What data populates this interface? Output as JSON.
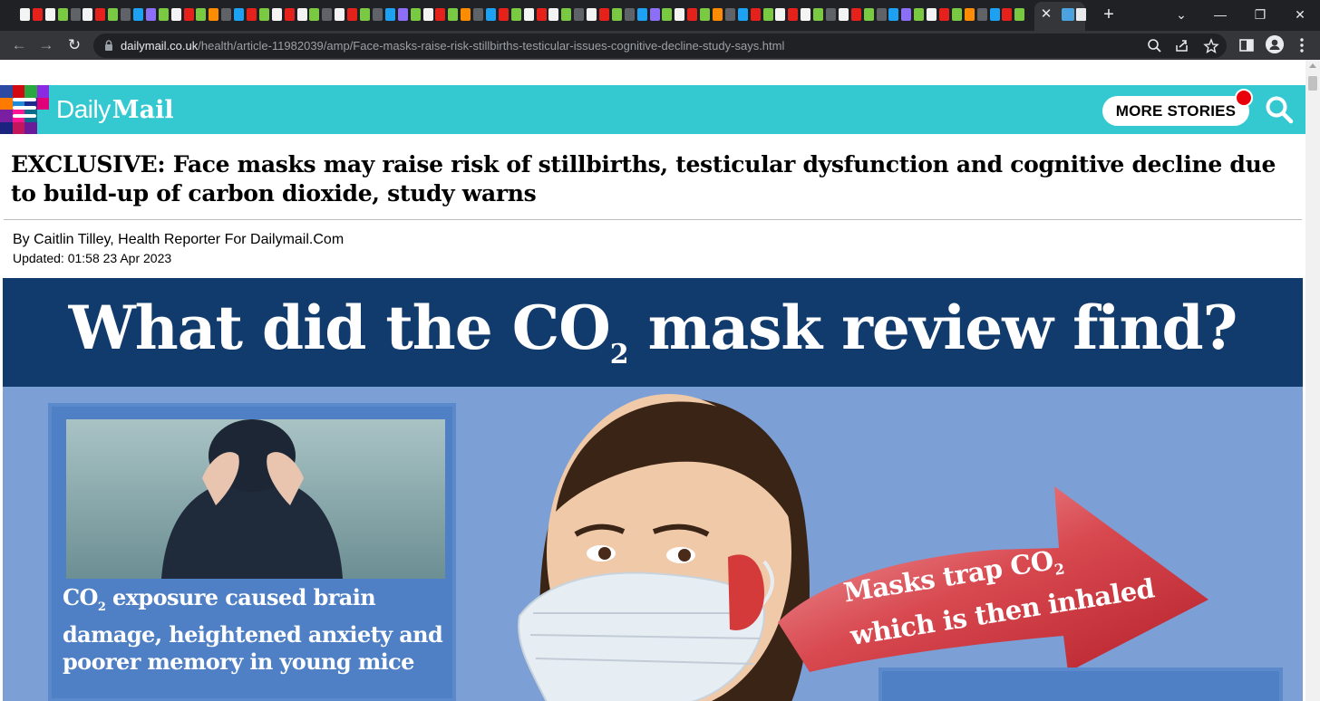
{
  "browser": {
    "url_domain": "dailymail.co.uk",
    "url_path": "/health/article-11982039/amp/Face-masks-raise-risk-stillbirths-testicular-issues-cognitive-decline-study-says.html",
    "tab_close_glyph": "✕",
    "new_tab_glyph": "+",
    "window_controls": {
      "tab_search": "⌄",
      "minimize": "—",
      "restore": "❐",
      "close": "✕"
    },
    "nav": {
      "back": "←",
      "forward": "→",
      "reload": "↻"
    },
    "toolbar_icons": [
      "zoom-icon",
      "share-icon",
      "bookmark-star-icon",
      "side-panel-icon",
      "profile-icon",
      "menu-icon"
    ]
  },
  "header": {
    "logo_daily": "Daily",
    "logo_mail": "Mail",
    "more_stories": "MORE STORIES",
    "accent_color": "#34c9d1",
    "notification_color": "#e8000a"
  },
  "article": {
    "headline": "EXCLUSIVE: Face masks may raise risk of stillbirths, testicular dysfunction and cognitive decline due to build-up of carbon dioxide, study warns",
    "byline": "By Caitlin Tilley, Health Reporter For Dailymail.Com",
    "updated": "Updated: 01:58 23 Apr 2023"
  },
  "hero_image": {
    "title_before": "What did the CO",
    "title_sub": "2",
    "title_after": " mask review find?",
    "inset_caption_a": "CO",
    "inset_caption_sub": "2",
    "inset_caption_b": " exposure caused brain damage, heightened anxiety and poorer memory in young mice",
    "arrow_line1_a": "Masks trap CO",
    "arrow_line1_sub": "2",
    "arrow_line2": "which is then inhaled"
  }
}
